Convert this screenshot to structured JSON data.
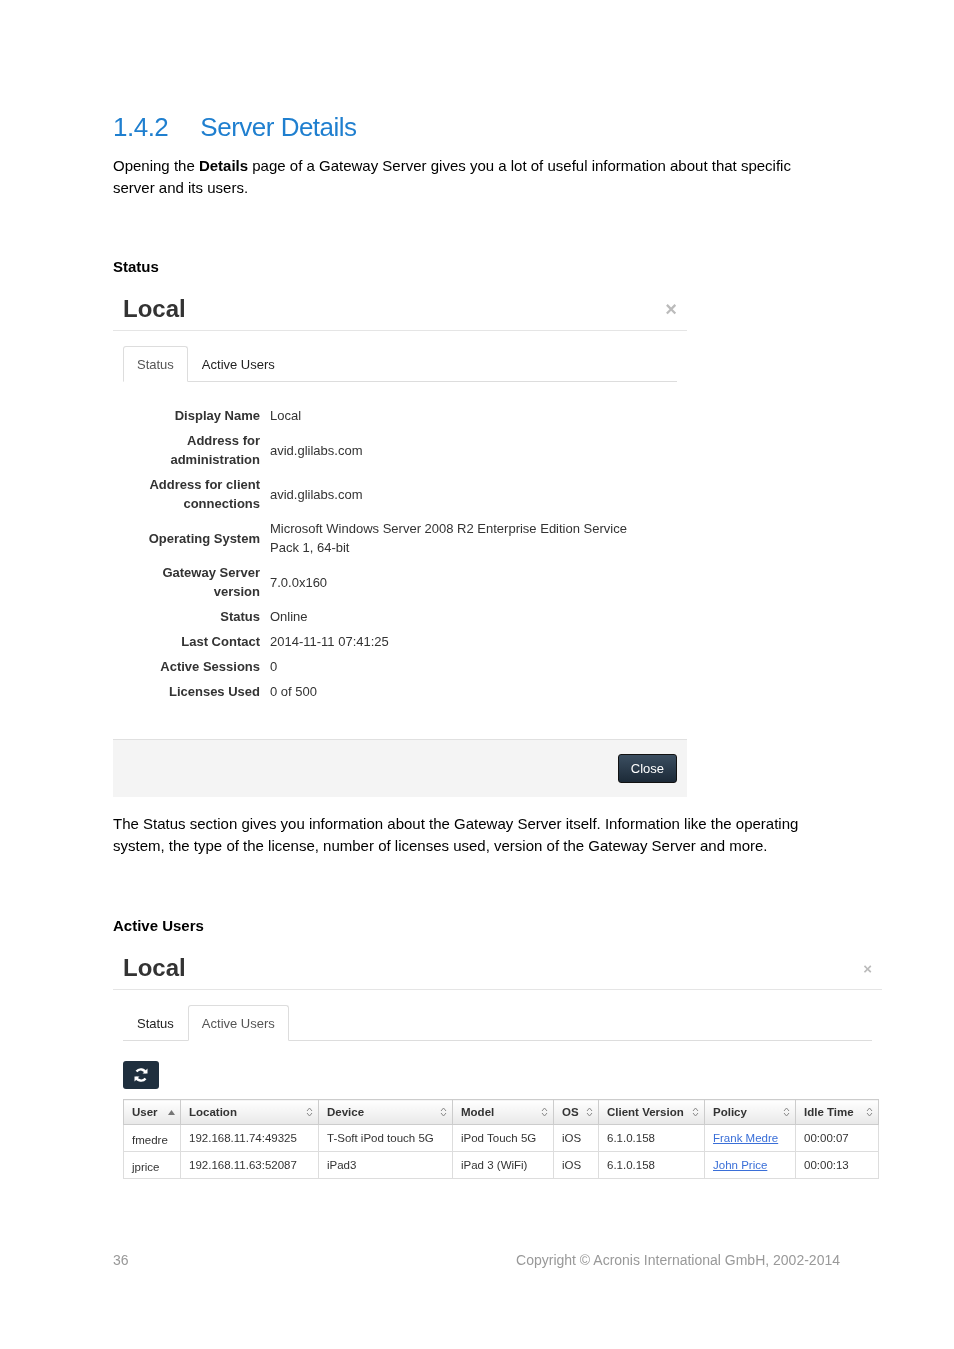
{
  "section": {
    "number": "1.4.2",
    "title": "Server Details"
  },
  "intro": "Opening the **Details** page of a Gateway Server gives you a lot of useful information about that specific server and its users.",
  "status_heading": "Status",
  "status_dialog": {
    "title": "Local",
    "close_icon": "×",
    "tabs": [
      {
        "label": "Status",
        "selected": true
      },
      {
        "label": "Active Users",
        "selected": false
      }
    ],
    "fields": [
      {
        "label": "Display Name",
        "value": "Local"
      },
      {
        "label": "Address for administration",
        "value": "avid.glilabs.com"
      },
      {
        "label": "Address for client connections",
        "value": "avid.glilabs.com"
      },
      {
        "label": "Operating System",
        "value": "Microsoft Windows Server 2008 R2 Enterprise Edition Service Pack 1, 64-bit"
      },
      {
        "label": "Gateway Server version",
        "value": "7.0.0x160"
      },
      {
        "label": "Status",
        "value": "Online"
      },
      {
        "label": "Last Contact",
        "value": "2014-11-11 07:41:25"
      },
      {
        "label": "Active Sessions",
        "value": "0"
      },
      {
        "label": "Licenses Used",
        "value": "0 of 500"
      }
    ],
    "close_button": "Close"
  },
  "status_text": "The Status section gives you information about the Gateway Server itself. Information like the operating system, the type of the license, number of licenses used, version of the Gateway Server and more.",
  "users_heading": "Active Users",
  "users_dialog": {
    "title": "Local",
    "close_icon": "×",
    "tabs": [
      {
        "label": "Status",
        "selected": false
      },
      {
        "label": "Active Users",
        "selected": true
      }
    ],
    "table": {
      "columns": [
        {
          "label": "User",
          "sorted": true
        },
        {
          "label": "Location",
          "sorted": false
        },
        {
          "label": "Device",
          "sorted": false
        },
        {
          "label": "Model",
          "sorted": false
        },
        {
          "label": "OS",
          "sorted": false
        },
        {
          "label": "Client Version",
          "sorted": false
        },
        {
          "label": "Policy",
          "sorted": false
        },
        {
          "label": "Idle Time",
          "sorted": false
        }
      ],
      "rows": [
        {
          "cells": [
            {
              "text": "fmedre",
              "kind": "text"
            },
            {
              "text": "192.168.11.74:49325",
              "kind": "text"
            },
            {
              "text": "T-Soft iPod touch 5G",
              "kind": "text"
            },
            {
              "text": "iPod Touch 5G",
              "kind": "text"
            },
            {
              "text": "iOS",
              "kind": "text"
            },
            {
              "text": "6.1.0.158",
              "kind": "text"
            },
            {
              "text": "Frank Medre",
              "kind": "link"
            },
            {
              "text": "00:00:07",
              "kind": "text"
            }
          ]
        },
        {
          "cells": [
            {
              "text": "jprice",
              "kind": "text"
            },
            {
              "text": "192.168.11.63:52087",
              "kind": "text"
            },
            {
              "text": "iPad3",
              "kind": "text"
            },
            {
              "text": "iPad 3 (WiFi)",
              "kind": "text"
            },
            {
              "text": "iOS",
              "kind": "text"
            },
            {
              "text": "6.1.0.158",
              "kind": "text"
            },
            {
              "text": "John Price",
              "kind": "link"
            },
            {
              "text": "00:00:13",
              "kind": "text"
            }
          ]
        }
      ]
    }
  },
  "footer": {
    "page": "36",
    "copyright": "Copyright © Acronis International GmbH, 2002-2014"
  }
}
